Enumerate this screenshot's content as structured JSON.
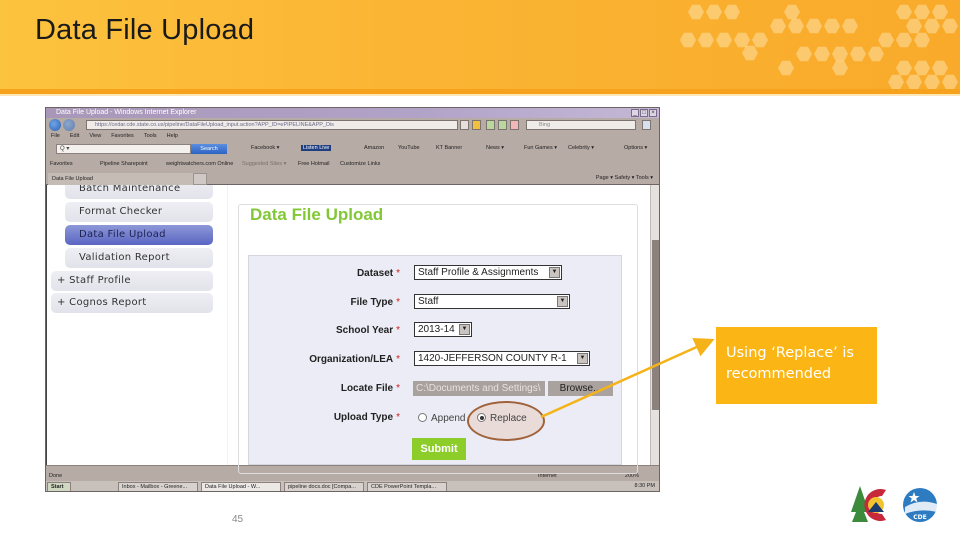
{
  "slide": {
    "title": "Data File Upload",
    "page_number": "45",
    "callout_text": "Using ‘Replace’ is recommended",
    "colors": {
      "banner": "#fbb534",
      "callout": "#fbb615",
      "accent_green": "#82c836",
      "arrow": "#f5b31a"
    }
  },
  "browser": {
    "window_title": "Data File Upload - Windows Internet Explorer",
    "url": "https://cedar.cde.state.co.us/pipeline/DataFileUpload_input.action?APP_ID=ePIPELINE&APP_Dis",
    "search_engine": "Bing",
    "menu": [
      "File",
      "Edit",
      "View",
      "Favorites",
      "Tools",
      "Help"
    ],
    "toolbar": {
      "search_placeholder": "Q ▾",
      "search_button": "Search",
      "items": [
        "Facebook ▾",
        "Listen Live",
        "Amazon",
        "YouTube",
        "KT Banner",
        "News ▾",
        "Fun Games ▾",
        "Celebrity ▾",
        "Options ▾"
      ]
    },
    "favorites_bar": [
      "Favorites",
      "Pipeline Sharepoint",
      "weightwatchers.com Online",
      "Suggested Sites ▾",
      "Free Hotmail",
      "Customize Links"
    ],
    "tab_title": "Data File Upload",
    "command_bar": "Page ▾   Safety ▾   Tools ▾",
    "status": "Done",
    "status_zone": "Internet",
    "zoom_level": "200%"
  },
  "sidebar": {
    "items": [
      {
        "label": "Batch Maintenance",
        "type": "sub",
        "active": false
      },
      {
        "label": "Format Checker",
        "type": "sub",
        "active": false
      },
      {
        "label": "Data File Upload",
        "type": "sub",
        "active": true
      },
      {
        "label": "Validation Report",
        "type": "sub",
        "active": false
      },
      {
        "label": "+ Staff Profile",
        "type": "top",
        "active": false
      },
      {
        "label": "+ Cognos Report",
        "type": "top",
        "active": false
      }
    ]
  },
  "form": {
    "heading": "Data File Upload",
    "required_marker": "*",
    "fields": {
      "dataset": {
        "label": "Dataset",
        "value": "Staff Profile & Assignments"
      },
      "file_type": {
        "label": "File Type",
        "value": "Staff"
      },
      "school_year": {
        "label": "School Year",
        "value": "2013-14"
      },
      "organization": {
        "label": "Organization/LEA",
        "value": "1420-JEFFERSON COUNTY R-1"
      },
      "locate_file": {
        "label": "Locate File",
        "value": "C:\\Documents and Settings\\",
        "browse_label": "Browse..."
      },
      "upload_type": {
        "label": "Upload Type",
        "options": [
          "Append",
          "Replace"
        ],
        "selected": "Replace"
      }
    },
    "submit_label": "Submit"
  },
  "taskbar": {
    "start_label": "Start",
    "tasks": [
      {
        "label": "Inbox - Mailbox - Greene...",
        "active": false
      },
      {
        "label": "Data File Upload - W...",
        "active": true
      },
      {
        "label": "pipeline docs.doc [Compa...",
        "active": false
      },
      {
        "label": "CDE PowerPoint Templa...",
        "active": false
      }
    ],
    "clock": "8:30 PM"
  },
  "logo": {
    "badge_text": "CDE"
  }
}
